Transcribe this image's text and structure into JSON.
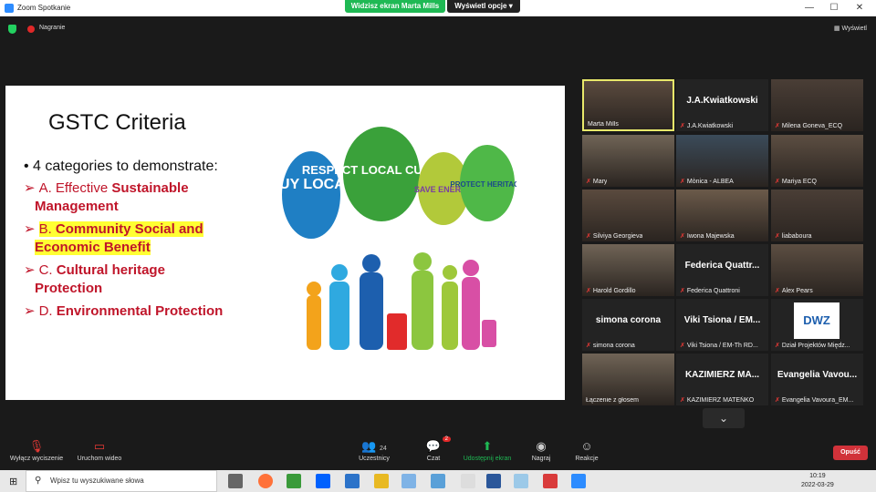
{
  "window": {
    "title": "Zoom Spotkanie",
    "share_banner": "Widzisz ekran Marta Mills",
    "view_options": "Wyświetl opcje ▾"
  },
  "meeting_bar": {
    "recording_label": "Nagranie",
    "view_label": "Wyświetl"
  },
  "slide": {
    "title": "GSTC Criteria",
    "bullet": "• 4 categories to demonstrate:",
    "items": [
      {
        "prefix": "A. Effective ",
        "bold": "Sustainable",
        "line2": "Management"
      },
      {
        "prefix": "B. ",
        "bold": "Community Social and",
        "line2": "Economic Benefit"
      },
      {
        "prefix": "C. ",
        "bold": "Cultural heritage",
        "line2": "Protection"
      },
      {
        "prefix": "D. ",
        "bold": "Environmental Protection",
        "line2": ""
      }
    ],
    "bubbles": [
      "BUY LOCAL",
      "RESPECT LOCAL CULTURE",
      "SAVE ENERGY",
      "PROTECT HERITAGE"
    ]
  },
  "participants": [
    {
      "name": "Marta Mills",
      "big": "",
      "muted": false,
      "video": true,
      "active": true
    },
    {
      "name": "J.A.Kwiatkowski",
      "big": "J.A.Kwiatkowski",
      "muted": true,
      "video": false
    },
    {
      "name": "Milena Goneva_ECQ",
      "big": "",
      "muted": true,
      "video": true
    },
    {
      "name": "Mary",
      "big": "",
      "muted": true,
      "video": true
    },
    {
      "name": "Mònica - ALBEA",
      "big": "",
      "muted": true,
      "video": true
    },
    {
      "name": "Mariya ECQ",
      "big": "",
      "muted": true,
      "video": true
    },
    {
      "name": "Silviya Georgieva",
      "big": "",
      "muted": true,
      "video": true
    },
    {
      "name": "Iwona Majewska",
      "big": "",
      "muted": true,
      "video": true
    },
    {
      "name": "liababoura",
      "big": "",
      "muted": true,
      "video": true
    },
    {
      "name": "Harold Gordillo",
      "big": "",
      "muted": true,
      "video": true
    },
    {
      "name": "Federica Quattroni",
      "big": "Federica Quattr...",
      "muted": true,
      "video": false
    },
    {
      "name": "Alex Pears",
      "big": "",
      "muted": true,
      "video": true
    },
    {
      "name": "simona corona",
      "big": "simona corona",
      "muted": true,
      "video": false
    },
    {
      "name": "Viki Tsiona / EM-Th RD...",
      "big": "Viki Tsiona / EM...",
      "muted": true,
      "video": false
    },
    {
      "name": "Dział Projektów Międz...",
      "big": "DWZ",
      "muted": true,
      "video": false
    },
    {
      "name": "Łączenie z głosem",
      "big": "",
      "muted": false,
      "video": true
    },
    {
      "name": "KAZIMIERZ MATEŃKO",
      "big": "KAZIMIERZ MA...",
      "muted": true,
      "video": false
    },
    {
      "name": "Evangelia Vavoura_EM...",
      "big": "Evangelia Vavou...",
      "muted": true,
      "video": false
    }
  ],
  "toolbar": {
    "mute": "Wyłącz wyciszenie",
    "video": "Uruchom wideo",
    "participants": "Uczestnicy",
    "participants_count": "24",
    "chat": "Czat",
    "chat_badge": "2",
    "share": "Udostępnij ekran",
    "record": "Nagraj",
    "reactions": "Reakcje",
    "leave": "Opuść"
  },
  "taskbar": {
    "search_placeholder": "Wpisz tu wyszukiwane słowa",
    "time": "10:19",
    "date": "2022-03-29"
  },
  "colors": {
    "share_green": "#1fb954",
    "leave_red": "#d1323a",
    "slide_red": "#c0152a",
    "highlight": "#ffff33"
  }
}
